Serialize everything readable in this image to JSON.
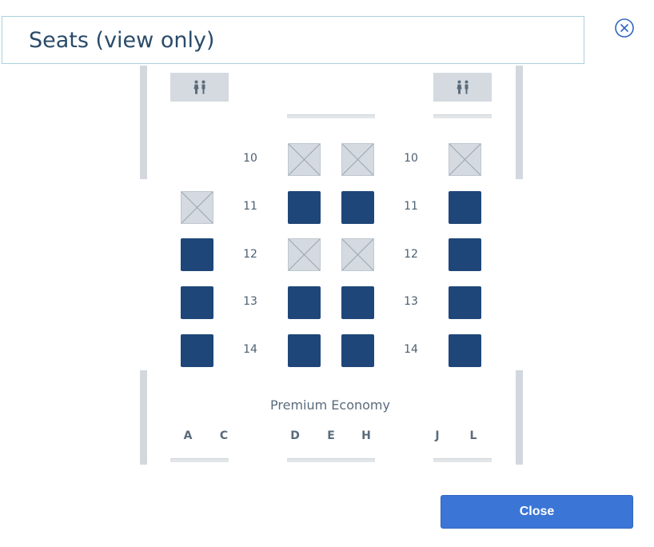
{
  "dialog": {
    "title": "Seats (view only)",
    "close_button_label": "Close"
  },
  "seat_map": {
    "cabin_label": "Premium Economy",
    "columns_left": [
      "A",
      "C"
    ],
    "columns_center": [
      "D",
      "E",
      "H"
    ],
    "columns_right": [
      "J",
      "L"
    ],
    "rows": [
      {
        "number": "10",
        "A": null,
        "D": "blocked",
        "H": "blocked",
        "L": "blocked"
      },
      {
        "number": "11",
        "A": "blocked",
        "D": "available",
        "H": "available",
        "L": "available"
      },
      {
        "number": "12",
        "A": "available",
        "D": "blocked",
        "H": "blocked",
        "L": "available"
      },
      {
        "number": "13",
        "A": "available",
        "D": "available",
        "H": "available",
        "L": "available"
      },
      {
        "number": "14",
        "A": "available",
        "D": "available",
        "H": "available",
        "L": "available"
      }
    ]
  },
  "colors": {
    "available_seat": "#1f4678",
    "blocked_seat": "#d4dae0",
    "primary_button": "#3b76d6",
    "title_border": "#a9d0dc"
  },
  "icons": {
    "close": "circle-x-icon",
    "lavatory": "restroom-icon"
  }
}
